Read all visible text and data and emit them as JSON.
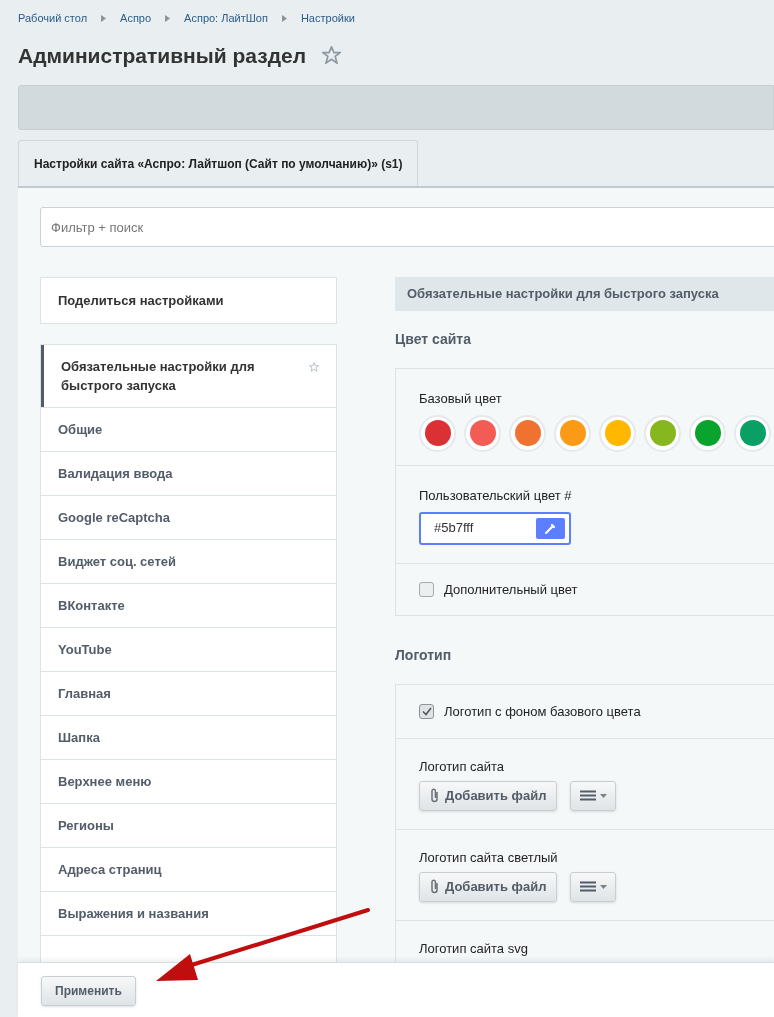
{
  "breadcrumbs": [
    "Рабочий стол",
    "Аспро",
    "Аспро: ЛайтШоп",
    "Настройки"
  ],
  "title": "Административный раздел",
  "tabs": [
    {
      "label": "Настройки сайта «Аспро: Лайтшоп (Сайт по умолчанию)» (s1)",
      "selected": true
    }
  ],
  "filter": {
    "placeholder": "Фильтр + поиск"
  },
  "share_button": "Поделиться настройками",
  "sidebar": {
    "items": [
      {
        "label": "Обязательные настройки для быстрого запуска",
        "selected": true,
        "starred": true
      },
      {
        "label": "Общие",
        "selected": false,
        "starred": false
      },
      {
        "label": "Валидация ввода",
        "selected": false,
        "starred": false
      },
      {
        "label": "Google reCaptcha",
        "selected": false,
        "starred": false
      },
      {
        "label": "Виджет соц. сетей",
        "selected": false,
        "starred": false
      },
      {
        "label": "ВКонтакте",
        "selected": false,
        "starred": false
      },
      {
        "label": "YouTube",
        "selected": false,
        "starred": false
      },
      {
        "label": "Главная",
        "selected": false,
        "starred": false
      },
      {
        "label": "Шапка",
        "selected": false,
        "starred": false
      },
      {
        "label": "Верхнее меню",
        "selected": false,
        "starred": false
      },
      {
        "label": "Регионы",
        "selected": false,
        "starred": false
      },
      {
        "label": "Адреса страниц",
        "selected": false,
        "starred": false
      },
      {
        "label": "Выражения и названия",
        "selected": false,
        "starred": false
      }
    ]
  },
  "section_header": "Обязательные настройки для быстрого запуска",
  "site_color": {
    "title": "Цвет сайта",
    "base_label": "Базовый цвет",
    "swatches": [
      {
        "color": "#db3034",
        "selected": false
      },
      {
        "color": "#f25c55",
        "selected": false
      },
      {
        "color": "#f07230",
        "selected": false
      },
      {
        "color": "#fb9a17",
        "selected": false
      },
      {
        "color": "#ffb700",
        "selected": false
      },
      {
        "color": "#86b71f",
        "selected": false
      },
      {
        "color": "#08a42d",
        "selected": false
      },
      {
        "color": "#0aa065",
        "selected": false
      }
    ],
    "custom_label": "Пользовательский цвет #",
    "custom_value": "#5b7fff",
    "extra": {
      "label": "Дополнительный цвет",
      "checked": false
    }
  },
  "logo": {
    "title": "Логотип",
    "checkbox": {
      "label": "Логотип с фоном базового цвета",
      "checked": true
    },
    "files": [
      {
        "label": "Логотип сайта",
        "button": "Добавить файл"
      },
      {
        "label": "Логотип сайта светлый",
        "button": "Добавить файл"
      },
      {
        "label": "Логотип сайта svg"
      }
    ]
  },
  "apply_button": "Применить"
}
